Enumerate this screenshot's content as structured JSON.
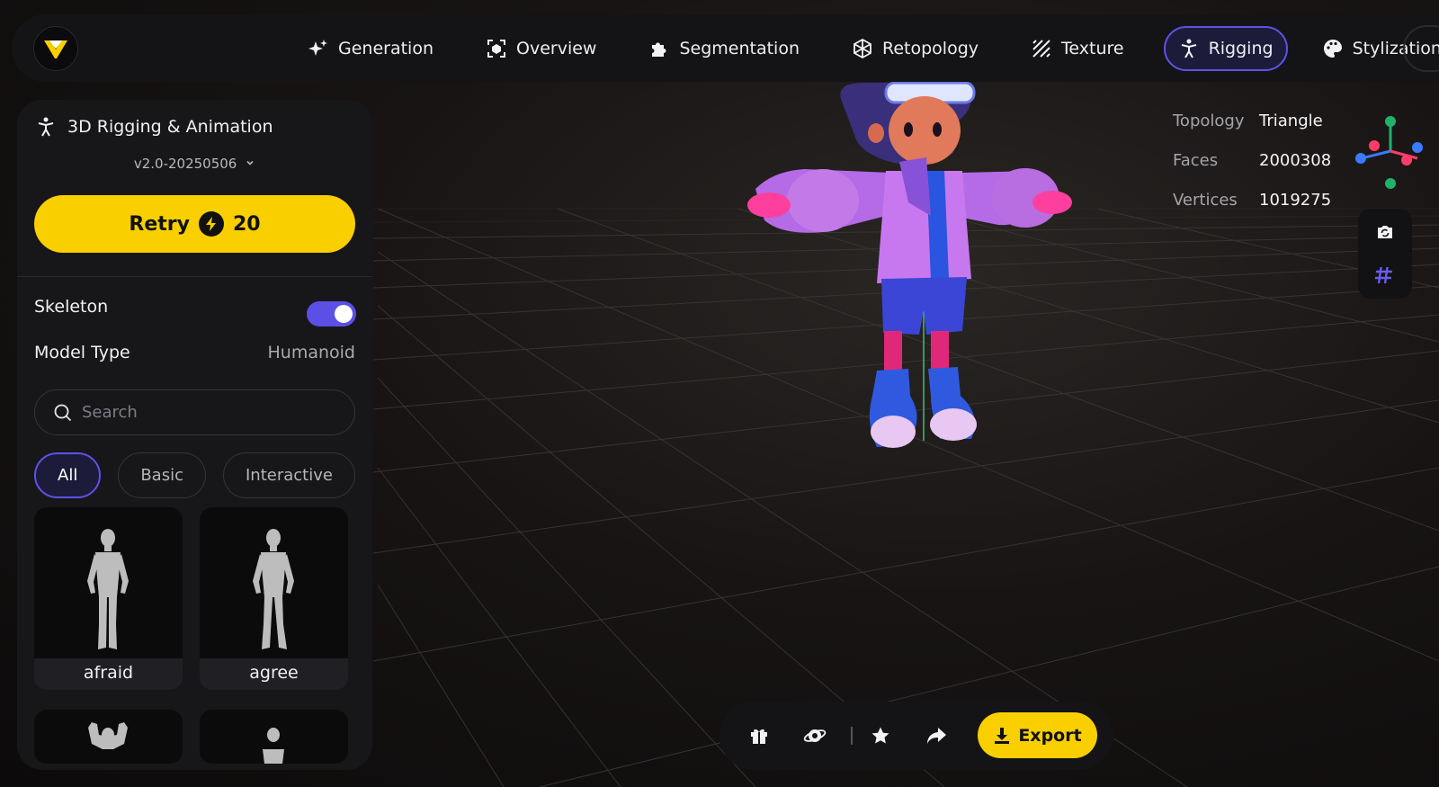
{
  "nav": {
    "items": [
      {
        "label": "Generation",
        "icon": "sparkle-icon",
        "active": false
      },
      {
        "label": "Overview",
        "icon": "cube-frame-icon",
        "active": false
      },
      {
        "label": "Segmentation",
        "icon": "puzzle-icon",
        "active": false
      },
      {
        "label": "Retopology",
        "icon": "mesh-icon",
        "active": false
      },
      {
        "label": "Texture",
        "icon": "texture-icon",
        "active": false
      },
      {
        "label": "Rigging",
        "icon": "figure-icon",
        "active": true
      },
      {
        "label": "Stylization",
        "icon": "palette-icon",
        "active": false
      }
    ]
  },
  "panel": {
    "title": "3D Rigging & Animation",
    "version": "v2.0-20250506",
    "retry_label": "Retry",
    "retry_cost": "20",
    "skeleton_label": "Skeleton",
    "skeleton_on": true,
    "model_type_label": "Model Type",
    "model_type_value": "Humanoid",
    "search_placeholder": "Search",
    "filters": [
      "All",
      "Basic",
      "Interactive"
    ],
    "active_filter": "All",
    "animations": [
      "afraid",
      "agree"
    ]
  },
  "model_info": {
    "topology_label": "Topology",
    "topology_value": "Triangle",
    "faces_label": "Faces",
    "faces_value": "2000308",
    "vertices_label": "Vertices",
    "vertices_value": "1019275"
  },
  "bottom": {
    "export_label": "Export"
  },
  "colors": {
    "accent": "#5b4fe5",
    "primary_button": "#f9cf00"
  }
}
